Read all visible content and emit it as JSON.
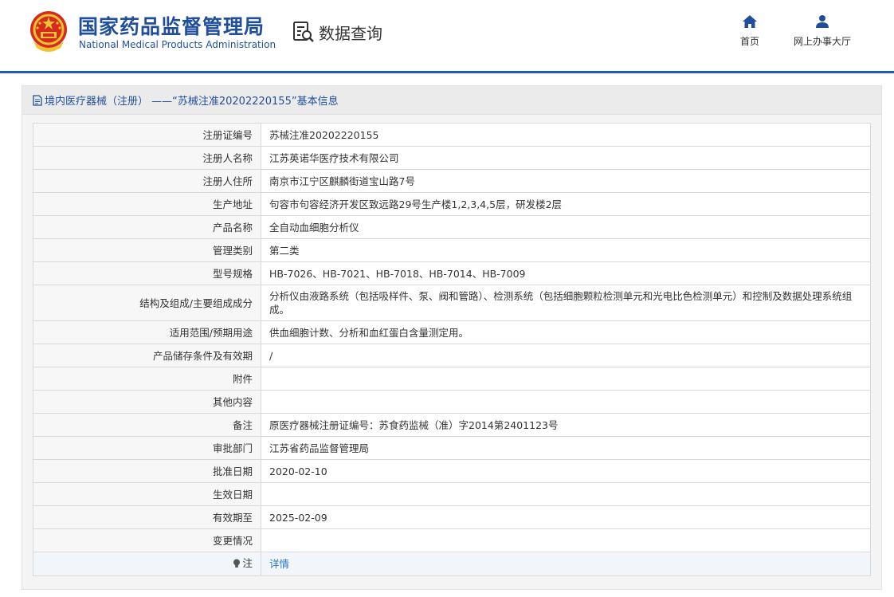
{
  "header": {
    "brand_cn": "国家药品监督管理局",
    "brand_en": "National Medical Products Administration",
    "query_label": "数据查询",
    "nav": [
      {
        "label": "首页",
        "icon": "home-icon"
      },
      {
        "label": "网上办事大厅",
        "icon": "user-icon"
      }
    ]
  },
  "panel": {
    "title": "境内医疗器械（注册） ——“苏械注准20202220155”基本信息",
    "title_icon": "document-icon"
  },
  "rows": [
    {
      "label": "注册证编号",
      "value": "苏械注准20202220155"
    },
    {
      "label": "注册人名称",
      "value": "江苏英诺华医疗技术有限公司"
    },
    {
      "label": "注册人住所",
      "value": "南京市江宁区麒麟街道宝山路7号"
    },
    {
      "label": "生产地址",
      "value": "句容市句容经济开发区致远路29号生产楼1,2,3,4,5层，研发楼2层"
    },
    {
      "label": "产品名称",
      "value": "全自动血细胞分析仪"
    },
    {
      "label": "管理类别",
      "value": "第二类"
    },
    {
      "label": "型号规格",
      "value": "HB-7026、HB-7021、HB-7018、HB-7014、HB-7009"
    },
    {
      "label": "结构及组成/主要组成成分",
      "value": "分析仪由液路系统（包括吸样件、泵、阀和管路）、检测系统（包括细胞颗粒检测单元和光电比色检测单元）和控制及数据处理系统组成。"
    },
    {
      "label": "适用范围/预期用途",
      "value": "供血细胞计数、分析和血红蛋白含量测定用。"
    },
    {
      "label": "产品储存条件及有效期",
      "value": "/"
    },
    {
      "label": "附件",
      "value": ""
    },
    {
      "label": "其他内容",
      "value": ""
    },
    {
      "label": "备注",
      "value": "原医疗器械注册证编号：苏食药监械（准）字2014第2401123号"
    },
    {
      "label": "审批部门",
      "value": "江苏省药品监督管理局"
    },
    {
      "label": "批准日期",
      "value": "2020-02-10"
    },
    {
      "label": "生效日期",
      "value": ""
    },
    {
      "label": "有效期至",
      "value": "2025-02-09"
    },
    {
      "label": "变更情况",
      "value": ""
    }
  ],
  "note_row": {
    "label": "注",
    "icon": "bulb-icon",
    "link": "详情"
  },
  "colors": {
    "brand_blue": "#1f4f9c",
    "header_line": "#1a5fae",
    "link_blue": "#2b74c7"
  }
}
